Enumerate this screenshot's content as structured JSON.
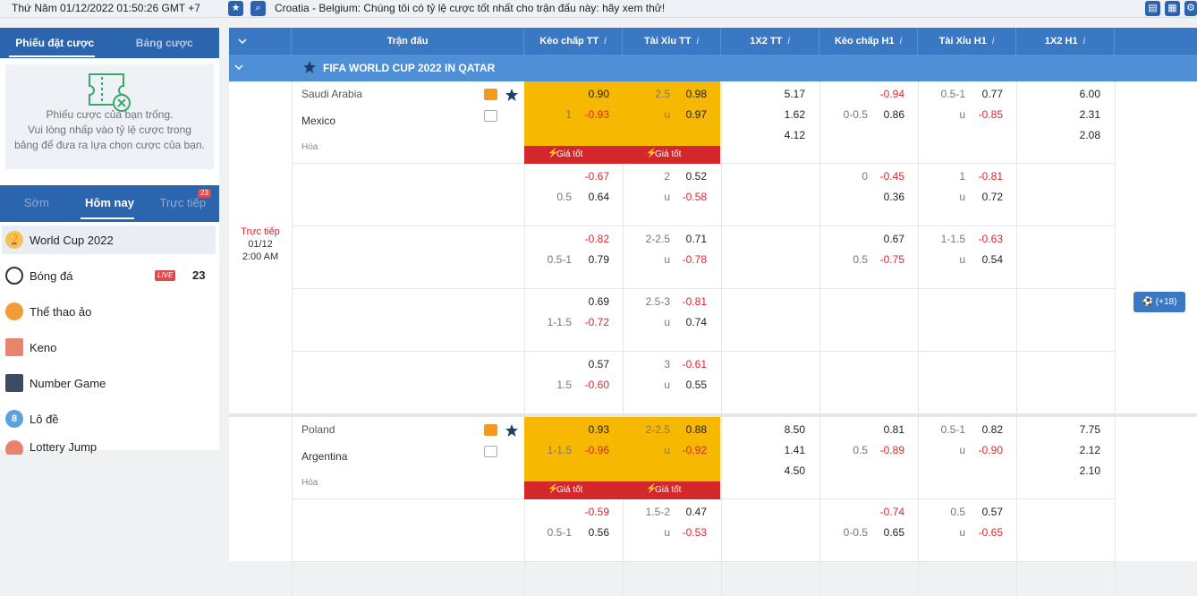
{
  "topbar": {
    "clock": "Thứ Năm 01/12/2022 01:50:26 GMT +7",
    "marquee": "Croatia - Belgium: Chúng tôi có tỷ lệ cược tốt nhất cho trận đấu này: hãy xem thử!"
  },
  "betslip": {
    "tabs": [
      "Phiếu đặt cược",
      "Bảng cược"
    ],
    "empty_lines": [
      "Phiếu cược của bạn trống.",
      "Vui lòng nhấp vào tỷ lệ cược trong",
      "bảng để đưa ra lựa chọn cược của bạn."
    ]
  },
  "time_tabs": {
    "items": [
      "Sớm",
      "Hôm nay",
      "Trực tiếp"
    ],
    "badge": "23"
  },
  "sports": [
    {
      "name": "World Cup 2022",
      "icon": "trophy-icon"
    },
    {
      "name": "Bóng đá",
      "icon": "soccer-ball-icon",
      "live": "LIVE",
      "count": "23"
    },
    {
      "name": "Thể thao ảo",
      "icon": "virtual-sports-icon"
    },
    {
      "name": "Keno",
      "icon": "keno-icon"
    },
    {
      "name": "Number Game",
      "icon": "number-game-icon"
    },
    {
      "name": "Lô đề",
      "icon": "lottery-ball-icon"
    },
    {
      "name": "Lottery Jump",
      "icon": "lottery-icon"
    }
  ],
  "header": {
    "match": "Trận đấu",
    "cols": [
      "Kèo chấp TT",
      "Tài Xỉu TT",
      "1X2 TT",
      "Kèo chấp H1",
      "Tài Xỉu H1",
      "1X2 H1"
    ],
    "info": "i"
  },
  "league": "FIFA WORLD CUP 2022 IN QATAR",
  "match_time": {
    "status": "Trực tiếp",
    "date": "01/12",
    "time": "2:00 AM"
  },
  "more_button": "(+18)",
  "good_price": "Giá tốt",
  "match1": {
    "home": "Saudi Arabia",
    "away": "Mexico",
    "draw": "Hòa",
    "rows": [
      {
        "hc_line": "1",
        "hc_home": "0.90",
        "hc_away": "-0.93",
        "ou_line": "2.5",
        "ou_u": "u",
        "ou_over": "0.98",
        "ou_under": "0.97",
        "x1": "5.17",
        "x2": "1.62",
        "xd": "4.12",
        "h_hc_line": "0-0.5",
        "h_hc_home": "-0.94",
        "h_hc_away": "0.86",
        "h_ou_line": "0.5-1",
        "h_ou_u": "u",
        "h_ou_over": "0.77",
        "h_ou_under": "-0.85",
        "h1": "6.00",
        "h2": "2.31",
        "hd": "2.08"
      },
      {
        "hc_line": "0.5",
        "hc_home": "-0.67",
        "hc_away": "0.64",
        "ou_line": "2",
        "ou_u": "u",
        "ou_over": "0.52",
        "ou_under": "-0.58",
        "h_hc_line": "0",
        "h_hc_home": "-0.45",
        "h_hc_away": "0.36",
        "h_ou_line": "1",
        "h_ou_u": "u",
        "h_ou_over": "-0.81",
        "h_ou_under": "0.72"
      },
      {
        "hc_line": "0.5-1",
        "hc_home": "-0.82",
        "hc_away": "0.79",
        "ou_line": "2-2.5",
        "ou_u": "u",
        "ou_over": "0.71",
        "ou_under": "-0.78",
        "h_hc_line": "0.5",
        "h_hc_home": "0.67",
        "h_hc_away": "-0.75",
        "h_ou_line": "1-1.5",
        "h_ou_u": "u",
        "h_ou_over": "-0.63",
        "h_ou_under": "0.54"
      },
      {
        "hc_line": "1-1.5",
        "hc_home": "0.69",
        "hc_away": "-0.72",
        "ou_line": "2.5-3",
        "ou_u": "u",
        "ou_over": "-0.81",
        "ou_under": "0.74"
      },
      {
        "hc_line": "1.5",
        "hc_home": "0.57",
        "hc_away": "-0.60",
        "ou_line": "3",
        "ou_u": "u",
        "ou_over": "-0.61",
        "ou_under": "0.55"
      }
    ]
  },
  "match2": {
    "home": "Poland",
    "away": "Argentina",
    "draw": "Hòa",
    "rows": [
      {
        "hc_line": "1-1.5",
        "hc_home": "0.93",
        "hc_away": "-0.96",
        "ou_line": "2-2.5",
        "ou_u": "u",
        "ou_over": "0.88",
        "ou_under": "-0.92",
        "x1": "8.50",
        "x2": "1.41",
        "xd": "4.50",
        "h_hc_line": "0.5",
        "h_hc_home": "0.81",
        "h_hc_away": "-0.89",
        "h_ou_line": "0.5-1",
        "h_ou_u": "u",
        "h_ou_over": "0.82",
        "h_ou_under": "-0.90",
        "h1": "7.75",
        "h2": "2.12",
        "hd": "2.10"
      },
      {
        "hc_line": "0.5-1",
        "hc_home": "-0.59",
        "hc_away": "0.56",
        "ou_line": "1.5-2",
        "ou_u": "u",
        "ou_over": "0.47",
        "ou_under": "-0.53",
        "h_hc_line": "0-0.5",
        "h_hc_home": "-0.74",
        "h_hc_away": "0.65",
        "h_ou_line": "0.5",
        "h_ou_u": "u",
        "h_ou_over": "0.57",
        "h_ou_under": "-0.65"
      }
    ]
  }
}
